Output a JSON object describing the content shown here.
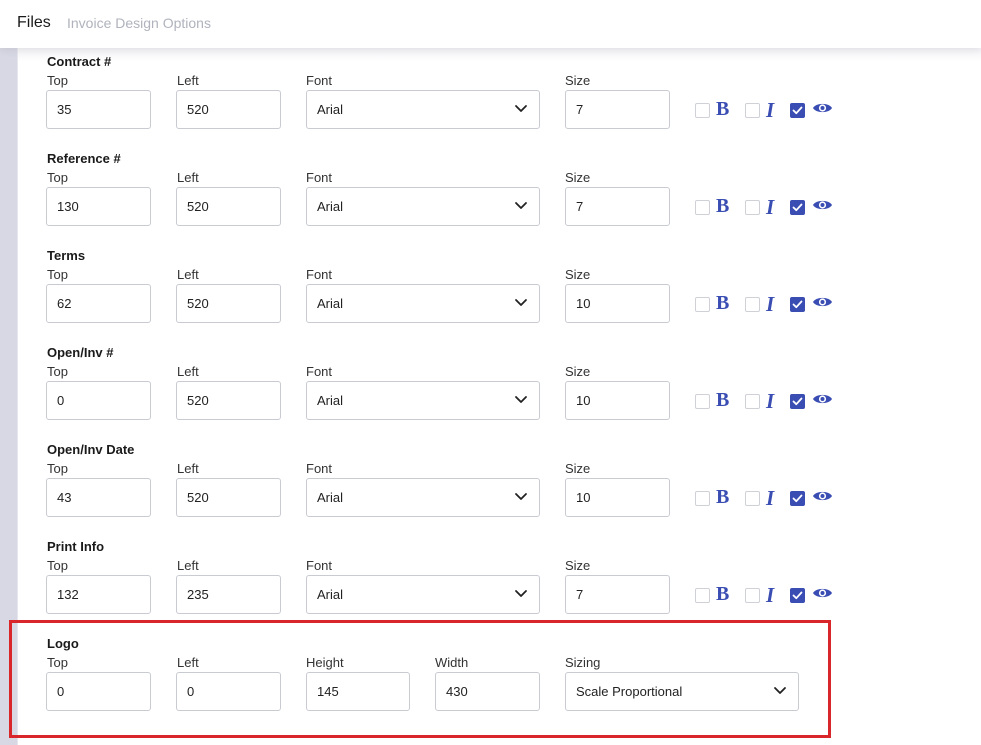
{
  "header": {
    "title": "Files",
    "subtitle": "Invoice Design Options"
  },
  "labels": {
    "top": "Top",
    "left": "Left",
    "font": "Font",
    "size": "Size",
    "height": "Height",
    "width": "Width",
    "sizing": "Sizing"
  },
  "sections": [
    {
      "title": "Contract #",
      "top": "35",
      "left": "520",
      "font": "Arial",
      "size": "7",
      "bold": false,
      "italic": false,
      "visible": true
    },
    {
      "title": "Reference #",
      "top": "130",
      "left": "520",
      "font": "Arial",
      "size": "7",
      "bold": false,
      "italic": false,
      "visible": true
    },
    {
      "title": "Terms",
      "top": "62",
      "left": "520",
      "font": "Arial",
      "size": "10",
      "bold": false,
      "italic": false,
      "visible": true
    },
    {
      "title": "Open/Inv #",
      "top": "0",
      "left": "520",
      "font": "Arial",
      "size": "10",
      "bold": false,
      "italic": false,
      "visible": true
    },
    {
      "title": "Open/Inv Date",
      "top": "43",
      "left": "520",
      "font": "Arial",
      "size": "10",
      "bold": false,
      "italic": false,
      "visible": true
    },
    {
      "title": "Print Info",
      "top": "132",
      "left": "235",
      "font": "Arial",
      "size": "7",
      "bold": false,
      "italic": false,
      "visible": true
    }
  ],
  "logo": {
    "title": "Logo",
    "top": "0",
    "left": "0",
    "height": "145",
    "width": "430",
    "sizing": "Scale Proportional"
  },
  "icons": {
    "bold": "B",
    "italic": "I",
    "visibility": "eye-icon",
    "dropdown": "chevron-down-icon"
  },
  "colors": {
    "accent": "#3a4db3",
    "highlight_border": "#d8262a",
    "sidebar": "#d7d8e3",
    "subtitle": "#b0b3bd"
  }
}
